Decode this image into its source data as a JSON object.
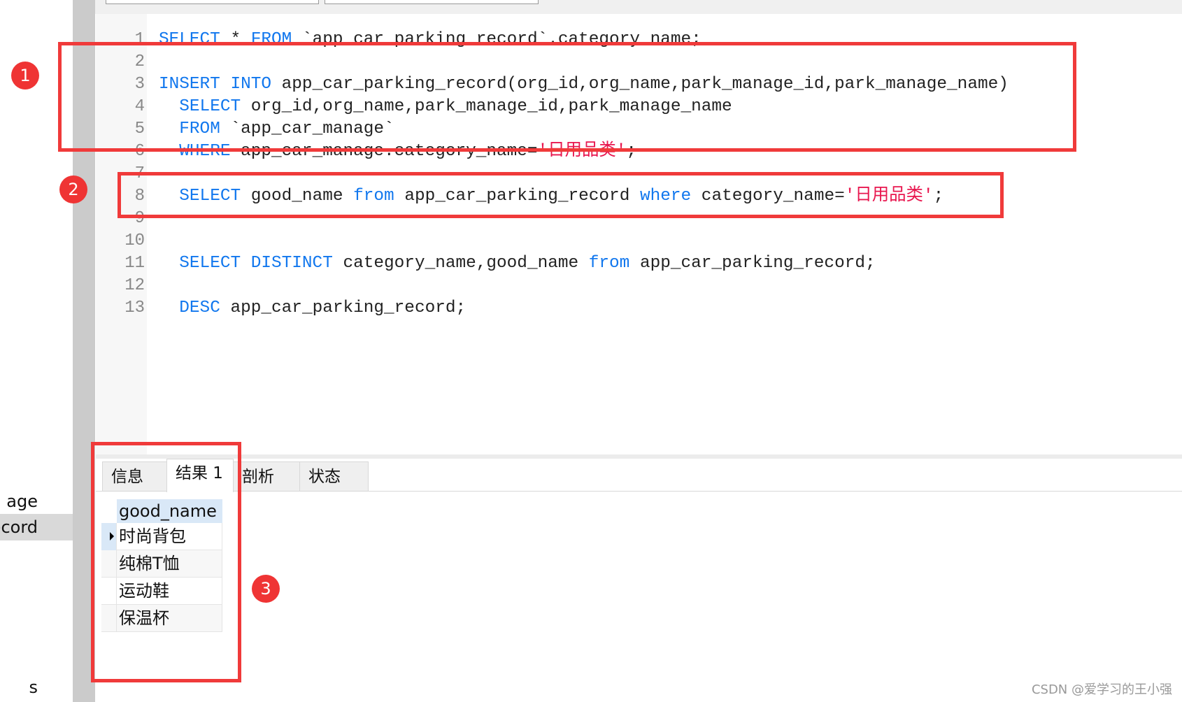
{
  "sidebar": {
    "items": [
      {
        "label": "age",
        "selected": false
      },
      {
        "label": "ecord",
        "selected": true
      },
      {
        "label": "s",
        "selected": false
      }
    ]
  },
  "editor": {
    "lines": [
      {
        "n": "1",
        "tokens": [
          {
            "t": "SELECT",
            "k": "kw"
          },
          {
            "t": " * "
          },
          {
            "t": "FROM",
            "k": "kw"
          },
          {
            "t": " `app_car_parking_record`.category_name;"
          }
        ]
      },
      {
        "n": "2",
        "tokens": []
      },
      {
        "n": "3",
        "tokens": [
          {
            "t": "INSERT INTO",
            "k": "kw"
          },
          {
            "t": " app_car_parking_record(org_id,org_name,park_manage_id,park_manage_name)"
          }
        ]
      },
      {
        "n": "4",
        "tokens": [
          {
            "t": "  "
          },
          {
            "t": "SELECT",
            "k": "kw"
          },
          {
            "t": " org_id,org_name,park_manage_id,park_manage_name"
          }
        ]
      },
      {
        "n": "5",
        "tokens": [
          {
            "t": "  "
          },
          {
            "t": "FROM",
            "k": "kw"
          },
          {
            "t": " `app_car_manage`"
          }
        ]
      },
      {
        "n": "6",
        "tokens": [
          {
            "t": "  "
          },
          {
            "t": "WHERE",
            "k": "kw"
          },
          {
            "t": " app_car_manage.category_name="
          },
          {
            "t": "'日用品类'",
            "k": "str"
          },
          {
            "t": ";"
          }
        ]
      },
      {
        "n": "7",
        "tokens": []
      },
      {
        "n": "8",
        "tokens": [
          {
            "t": "  "
          },
          {
            "t": "SELECT",
            "k": "kw"
          },
          {
            "t": " good_name "
          },
          {
            "t": "from",
            "k": "kw"
          },
          {
            "t": " app_car_parking_record "
          },
          {
            "t": "where",
            "k": "kw"
          },
          {
            "t": " category_name="
          },
          {
            "t": "'日用品类'",
            "k": "str"
          },
          {
            "t": ";"
          }
        ]
      },
      {
        "n": "9",
        "tokens": []
      },
      {
        "n": "10",
        "tokens": []
      },
      {
        "n": "11",
        "tokens": [
          {
            "t": "  "
          },
          {
            "t": "SELECT DISTINCT",
            "k": "kw"
          },
          {
            "t": " category_name,good_name "
          },
          {
            "t": "from",
            "k": "kw"
          },
          {
            "t": " app_car_parking_record;"
          }
        ]
      },
      {
        "n": "12",
        "tokens": []
      },
      {
        "n": "13",
        "tokens": [
          {
            "t": "  "
          },
          {
            "t": "DESC",
            "k": "kw"
          },
          {
            "t": " app_car_parking_record;"
          }
        ]
      }
    ]
  },
  "results": {
    "tabs": [
      {
        "label": "信息",
        "active": false
      },
      {
        "label": "结果 1",
        "active": true
      },
      {
        "label": "剖析",
        "active": false
      },
      {
        "label": "状态",
        "active": false
      }
    ],
    "column": "good_name",
    "rows": [
      "时尚背包",
      "纯棉T恤",
      "运动鞋",
      "保温杯"
    ]
  },
  "annotations": [
    "1",
    "2",
    "3"
  ],
  "watermark": "CSDN @爱学习的王小强",
  "colors": {
    "keyword": "#1177ee",
    "string": "#e8174f",
    "annotation": "#f03a3a"
  }
}
